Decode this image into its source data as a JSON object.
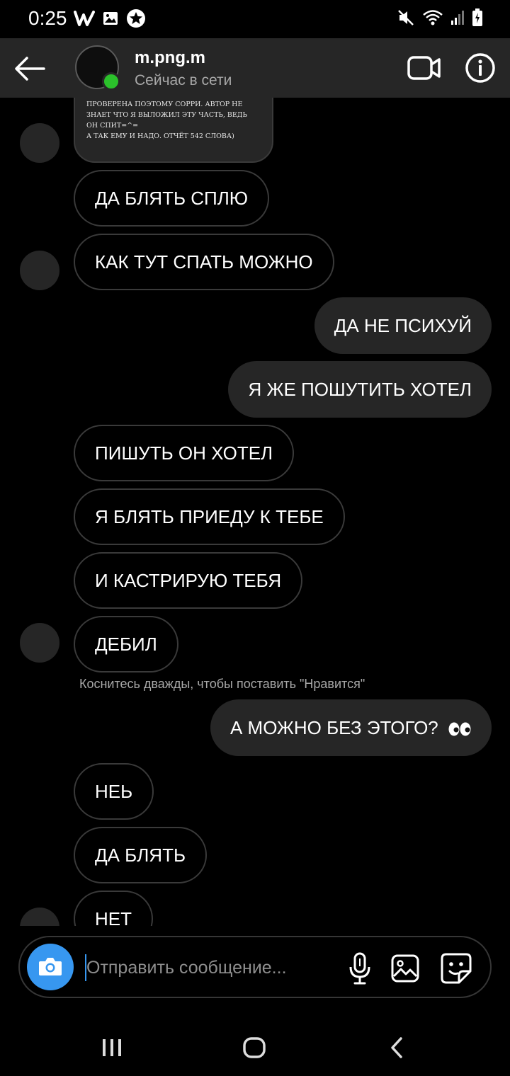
{
  "status_bar": {
    "time": "0:25",
    "left_icons": [
      "wattpad-icon",
      "image-icon",
      "star-badge-icon"
    ],
    "right_icons": [
      "mute-icon",
      "wifi-icon",
      "signal-icon",
      "battery-charging-icon"
    ]
  },
  "header": {
    "contact_name": "m.png.m",
    "contact_status": "Сейчас в сети",
    "online_color": "#2bc12b"
  },
  "thread": {
    "partial_message_lines": [
      "проверена поэтому сорри. автор не",
      "знает что я выложил эту часть, ведь",
      "он спит=^=",
      "а так ему и надо. отчёт 542 слова)"
    ],
    "messages": [
      {
        "side": "in",
        "text": "ДА БЛЯТЬ СПЛЮ"
      },
      {
        "side": "in",
        "text": "КАК ТУТ СПАТЬ МОЖНО",
        "avatar": true
      },
      {
        "side": "out",
        "text": "ДА НЕ ПСИХУЙ"
      },
      {
        "side": "out",
        "text": "Я ЖЕ ПОШУТИТЬ ХОТЕЛ"
      },
      {
        "side": "in",
        "text": "ПИШУТЬ ОН ХОТЕЛ"
      },
      {
        "side": "in",
        "text": "Я БЛЯТЬ ПРИЕДУ К ТЕБЕ"
      },
      {
        "side": "in",
        "text": "И КАСТРИРУЮ ТЕБЯ"
      },
      {
        "side": "in",
        "text": "ДЕБИЛ",
        "avatar": true
      },
      {
        "side": "out",
        "text": "А МОЖНО БЕЗ ЭТОГО?"
      },
      {
        "side": "in",
        "text": "НЕЬ"
      },
      {
        "side": "in",
        "text": "ДА БЛЯТЬ"
      },
      {
        "side": "in",
        "text": "НЕТ",
        "avatar": true
      }
    ],
    "like_hint": "Коснитесь дважды, чтобы поставить \"Нравится\""
  },
  "composer": {
    "placeholder": "Отправить сообщение...",
    "accent_color": "#3797f0"
  },
  "nav_bar": {
    "buttons": [
      "recent-apps-icon",
      "home-icon",
      "back-icon"
    ]
  }
}
